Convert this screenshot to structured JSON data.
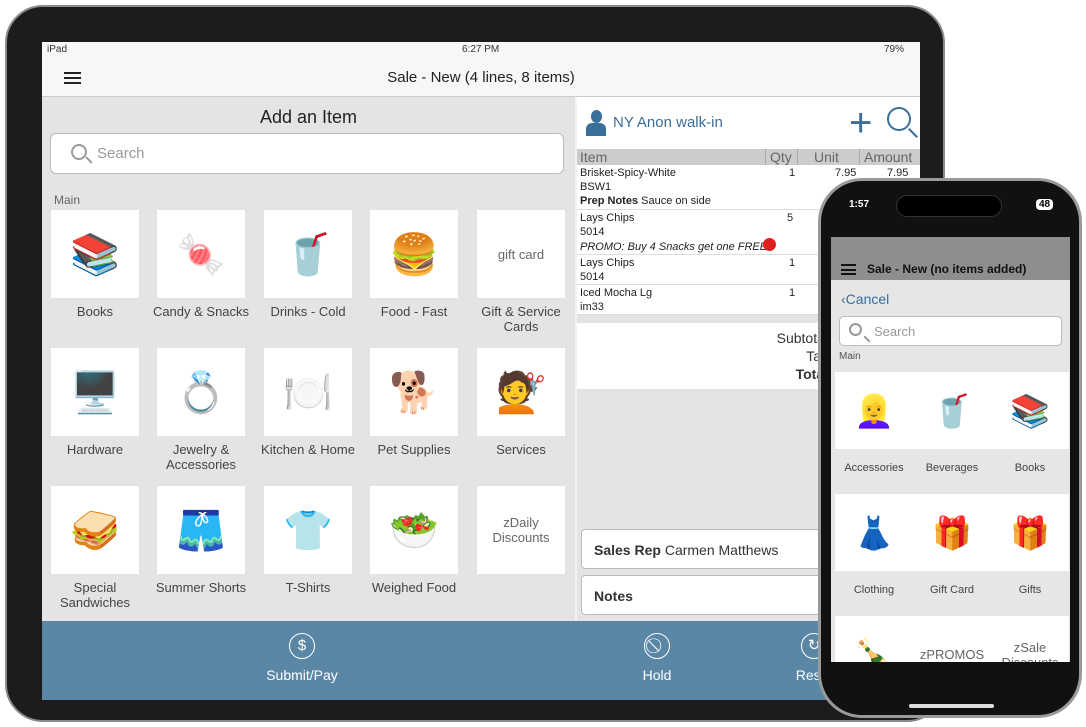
{
  "ipad": {
    "status": {
      "device": "iPad",
      "time": "6:27 PM",
      "battery": "79%"
    },
    "title": "Sale - New (4 lines, 8 items)",
    "add_item": {
      "heading": "Add an Item",
      "search_placeholder": "Search",
      "section": "Main",
      "tiles": [
        {
          "label": "Books",
          "icon": "📚"
        },
        {
          "label": "Candy & Snacks",
          "icon": "🍬"
        },
        {
          "label": "Drinks - Cold",
          "icon": "🥤"
        },
        {
          "label": "Food - Fast",
          "icon": "🍔"
        },
        {
          "label": "Gift & Service Cards",
          "icon": "gift card",
          "image_text": "gift card"
        },
        {
          "label": "Hardware",
          "icon": "🖥️"
        },
        {
          "label": "Jewelry & Accessories",
          "icon": "💍"
        },
        {
          "label": "Kitchen & Home",
          "icon": "🍽️"
        },
        {
          "label": "Pet Supplies",
          "icon": "🐕"
        },
        {
          "label": "Services",
          "icon": "💇"
        },
        {
          "label": "Special Sandwiches",
          "icon": "🥪"
        },
        {
          "label": "Summer Shorts",
          "icon": "🩳"
        },
        {
          "label": "T-Shirts",
          "icon": "👕"
        },
        {
          "label": "Weighed Food",
          "icon": "🥗"
        },
        {
          "label": "",
          "image_text": "zDaily Discounts"
        }
      ]
    },
    "customer": "NY Anon walk-in",
    "table": {
      "headers": [
        "Item",
        "Qty",
        "Unit",
        "Amount"
      ],
      "rows": [
        {
          "item": "Brisket-Spicy-White",
          "sku": "BSW1",
          "qty": "1",
          "unit": "7.95",
          "amount": "7.95",
          "note_label": "Prep Notes",
          "note": "Sauce on side"
        },
        {
          "item": "Lays Chips",
          "sku": "5014",
          "qty": "5",
          "promo": "PROMO: Buy 4 Snacks get one FREE"
        },
        {
          "item": "Lays Chips",
          "sku": "5014",
          "qty": "1"
        },
        {
          "item": "Iced Mocha Lg",
          "sku": "im33",
          "qty": "1"
        }
      ]
    },
    "totals": {
      "subtotal": "Subtotal",
      "tax": "Tax",
      "total": "Total"
    },
    "sales_rep_label": "Sales Rep",
    "sales_rep": "Carmen Matthews",
    "notes": "Notes",
    "actions": {
      "submit": "Submit/Pay",
      "hold": "Hold",
      "reset": "Reset"
    },
    "accent": "#5b87a7"
  },
  "iphone": {
    "status": {
      "time": "1:57",
      "battery": "48"
    },
    "title": "Sale - New (no items added)",
    "cancel": "Cancel",
    "search_placeholder": "Search",
    "section": "Main",
    "tiles": [
      {
        "label": "Accessories",
        "icon": "👱‍♀️"
      },
      {
        "label": "Beverages",
        "icon": "🥤"
      },
      {
        "label": "Books",
        "icon": "📚"
      },
      {
        "label": "Clothing",
        "icon": "👗"
      },
      {
        "label": "Gift Card",
        "icon": "🎁"
      },
      {
        "label": "Gifts",
        "icon": "🎁"
      },
      {
        "label": "",
        "icon": "🍾"
      },
      {
        "label": "",
        "image_text": "zPROMOS"
      },
      {
        "label": "",
        "image_text": "zSale Discounts"
      }
    ]
  }
}
